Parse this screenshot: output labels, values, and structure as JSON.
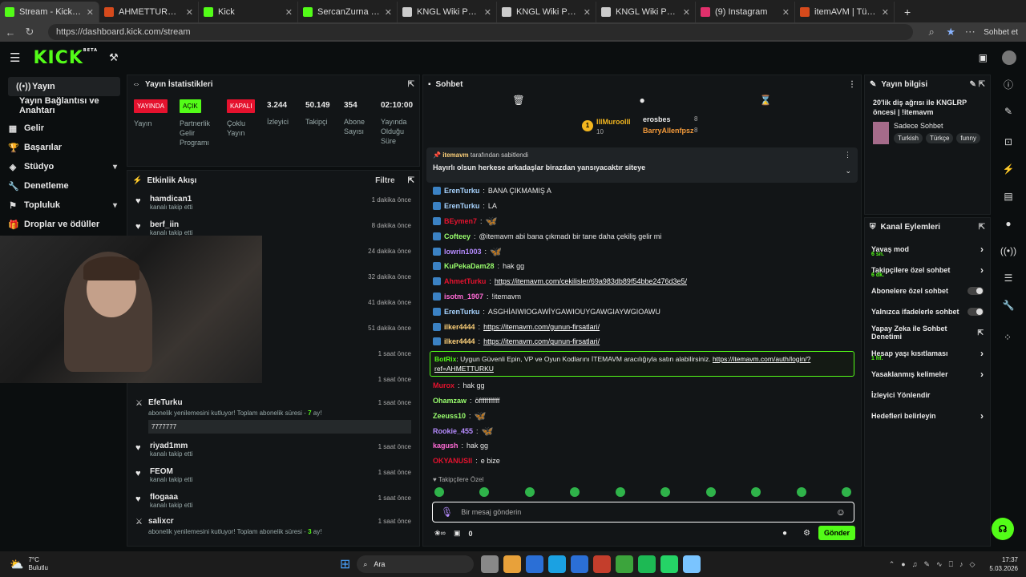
{
  "browser": {
    "tabs": [
      {
        "title": "Stream - Kick Dashboard",
        "color": "#53fc18"
      },
      {
        "title": "AHMETTURKU X ITEMAVM",
        "color": "#d64a1c"
      },
      {
        "title": "Kick",
        "color": "#53fc18"
      },
      {
        "title": "SercanZurna Stream - V",
        "color": "#53fc18"
      },
      {
        "title": "KNGL Wiki Portal",
        "color": "#ccc"
      },
      {
        "title": "KNGL Wiki Portal",
        "color": "#ccc"
      },
      {
        "title": "KNGL Wiki Portal",
        "color": "#ccc"
      },
      {
        "title": "(9) Instagram",
        "color": "#e1306c"
      },
      {
        "title": "itemAVM | Türkiye'nin #",
        "color": "#d64a1c"
      }
    ],
    "url": "https://dashboard.kick.com/stream",
    "profile_label": "Sohbet et"
  },
  "sidebar": {
    "items": [
      {
        "label": "Yayın",
        "icon": "broadcast-icon",
        "chev": ""
      },
      {
        "label": "Yayın Bağlantısı ve Anahtarı",
        "icon": "",
        "chev": ""
      },
      {
        "label": "Gelir",
        "icon": "grid-icon",
        "chev": ""
      },
      {
        "label": "Başarılar",
        "icon": "trophy-icon",
        "chev": ""
      },
      {
        "label": "Stüdyo",
        "icon": "studio-icon",
        "chev": "▾"
      },
      {
        "label": "Denetleme",
        "icon": "wrench-icon",
        "chev": ""
      },
      {
        "label": "Topluluk",
        "icon": "community-icon",
        "chev": "▾"
      },
      {
        "label": "Droplar ve ödüller",
        "icon": "gift-icon",
        "chev": ""
      }
    ]
  },
  "stats": {
    "title": "Yayın İstatistikleri",
    "badges": [
      {
        "text": "YAYINDA",
        "label": "Yayın",
        "bg": "#e5122e",
        "fg": "#fff"
      },
      {
        "text": "AÇIK",
        "label": "Partnerlik Gelir Programı",
        "bg": "#53fc18",
        "fg": "#000"
      },
      {
        "text": "KAPALI",
        "label": "Çoklu Yayın",
        "bg": "#e5122e",
        "fg": "#fff"
      }
    ],
    "values": [
      {
        "v": "3.244",
        "l": "İzleyici"
      },
      {
        "v": "50.149",
        "l": "Takipçi"
      },
      {
        "v": "354",
        "l": "Abone Sayısı"
      },
      {
        "v": "02:10:00",
        "l": "Yayında Olduğu Süre"
      }
    ]
  },
  "activity": {
    "title": "Etkinlik Akışı",
    "filter": "Filtre",
    "rows": [
      {
        "n": "hamdican1",
        "s": "kanalı takip etti",
        "t": "1 dakika önce",
        "i": "♥"
      },
      {
        "n": "berf_iin",
        "s": "kanalı takip etti",
        "t": "8 dakika önce",
        "i": "♥"
      },
      {
        "n": "",
        "s": "",
        "t": "24 dakika önce",
        "i": ""
      },
      {
        "n": "",
        "s": "",
        "t": "32 dakika önce",
        "i": ""
      },
      {
        "n": "",
        "s": "",
        "t": "41 dakika önce",
        "i": ""
      },
      {
        "n": "",
        "s": "",
        "t": "51 dakika önce",
        "i": ""
      },
      {
        "n": "",
        "s": "",
        "t": "1 saat önce",
        "i": ""
      },
      {
        "n": "",
        "s": "kanalı takip etti",
        "t": "1 saat önce",
        "i": "♥"
      }
    ],
    "efe": {
      "n": "EfeTurku",
      "s1": "abonelik yenilemesini kutluyor! Toplam abonelik süresi - ",
      "s2": "7",
      "s3": " ay!",
      "t": "1 saat önce",
      "box": "7777777"
    },
    "rows2": [
      {
        "n": "riyad1mm",
        "s": "kanalı takip etti",
        "t": "1 saat önce",
        "i": "♥"
      },
      {
        "n": "FEOM",
        "s": "kanalı takip etti",
        "t": "1 saat önce",
        "i": "♥"
      },
      {
        "n": "flogaaa",
        "s": "kanalı takip etti",
        "t": "1 saat önce",
        "i": "♥"
      }
    ],
    "salix": {
      "n": "salixcr",
      "s1": "abonelik yenilemesini kutluyor! Toplam abonelik süresi - ",
      "s2": "3",
      "s3": " ay!",
      "t": "1 saat önce"
    }
  },
  "chat": {
    "title": "Sohbet",
    "top": {
      "rank1": "1",
      "name1": "IllMuroolll",
      "n1": "10",
      "name2": "erosbes",
      "n2": "8",
      "name3": "BarryAllenfpsz",
      "n3": "8"
    },
    "pinned": {
      "by": "itemavm",
      "by_suffix": "tarafından sabitlendi",
      "text": "Hayırlı olsun herkese arkadaşlar birazdan yansıyacaktır siteye"
    },
    "messages": [
      {
        "u": "ErenTurku",
        "c": "#a8d4ff",
        "t": "BANA ÇIKMAMIŞ A",
        "link": ""
      },
      {
        "u": "ErenTurku",
        "c": "#a8d4ff",
        "t": "LA",
        "link": ""
      },
      {
        "u": "BEymen7",
        "c": "#e5122e",
        "t": "",
        "link": "",
        "e": "🦋"
      },
      {
        "u": "Cofteey",
        "c": "#9aff6e",
        "t": "@itemavm abi bana çıkmadı bir tane daha çekiliş gelir mi",
        "link": ""
      },
      {
        "u": "lowrin1003",
        "c": "#b68cff",
        "t": "",
        "link": "",
        "e": "🦋"
      },
      {
        "u": "KuPekaDam28",
        "c": "#9aff6e",
        "t": "hak gg",
        "link": ""
      },
      {
        "u": "AhmetTurku",
        "c": "#e5122e",
        "t": "",
        "link": "https://itemavm.com/cekilisler/69a983db89f54bbe2476d3e5/"
      },
      {
        "u": "isotm_1907",
        "c": "#ff6ad5",
        "t": "!itemavm",
        "link": ""
      },
      {
        "u": "ErenTurku",
        "c": "#a8d4ff",
        "t": "ASGHİAIWIOGAWİYGAWIOUYGAWGIAYWGIOAWU",
        "link": ""
      },
      {
        "u": "ilker4444",
        "c": "#ffd27a",
        "t": "",
        "link": "https://itemavm.com/gunun-firsatlari/"
      },
      {
        "u": "ilker4444",
        "c": "#ffd27a",
        "t": "",
        "link": "https://itemavm.com/gunun-firsatlari/"
      }
    ],
    "botrix": {
      "u": "BotRix",
      "t": "Uygun Güvenli Epin, VP ve Oyun Kodlarını İTEMAVM aracılığıyla satın alabilirsiniz.",
      "link": "https://itemavm.com/auth/login/?ref=AHMETTURKU"
    },
    "messages2": [
      {
        "u": "Murox",
        "c": "#e5122e",
        "t": "hak gg"
      },
      {
        "u": "Ohamzaw",
        "c": "#9aff6e",
        "t": "öfffffffffff"
      },
      {
        "u": "Zeeuss10",
        "c": "#9aff6e",
        "t": "",
        "e": "🦋"
      },
      {
        "u": "Rookie_455",
        "c": "#b68cff",
        "t": "",
        "e": "🦋"
      },
      {
        "u": "kagush",
        "c": "#ff6ad5",
        "t": "hak gg"
      },
      {
        "u": "OKYANUSII",
        "c": "#e5122e",
        "t": "e bize"
      }
    ],
    "followers_only": "Takipçilere Özel",
    "input_placeholder": "Bir mesaj gönderin",
    "send": "Gönder",
    "count0": "0"
  },
  "info": {
    "title": "Yayın bilgisi",
    "stream_title": "20'lik diş ağrısı ile KNGLRP öncesi | !itemavm",
    "category": "Sadece Sohbet",
    "tags": [
      "Turkish",
      "Türkçe",
      "funny"
    ]
  },
  "actions": {
    "title": "Kanal Eylemleri",
    "items": [
      {
        "l": "Yavaş mod",
        "s": "6 sn.",
        "k": "arrow"
      },
      {
        "l": "Takipçilere özel sohbet",
        "s": "6 dk.",
        "k": "arrow"
      },
      {
        "l": "Abonelere özel sohbet",
        "s": "",
        "k": "toggle"
      },
      {
        "l": "Yalnızca ifadelerle sohbet",
        "s": "",
        "k": "toggle"
      },
      {
        "l": "Yapay Zeka ile Sohbet Denetimi",
        "s": "",
        "k": "link"
      },
      {
        "l": "Hesap yaşı kısıtlaması",
        "s": "1 hf.",
        "k": "arrow"
      },
      {
        "l": "Yasaklanmış kelimeler",
        "s": "",
        "k": "arrow"
      },
      {
        "l": "İzleyici Yönlendir",
        "s": "",
        "k": ""
      },
      {
        "l": "Hedefleri belirleyin",
        "s": "",
        "k": "arrow"
      }
    ]
  },
  "taskbar": {
    "weather": "7°C",
    "weather2": "Bulutlu",
    "search": "Ara",
    "time": "17:37",
    "date": "5.03.2026"
  }
}
